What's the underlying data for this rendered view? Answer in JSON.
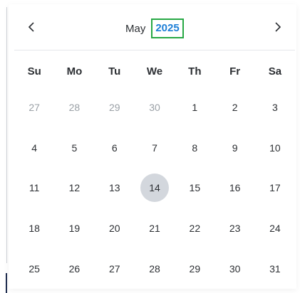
{
  "header": {
    "month": "May",
    "year": "2025",
    "prev_icon": "chevron-left-icon",
    "next_icon": "chevron-right-icon"
  },
  "weekdays": [
    "Su",
    "Mo",
    "Tu",
    "We",
    "Th",
    "Fr",
    "Sa"
  ],
  "days": [
    {
      "label": "27",
      "muted": true
    },
    {
      "label": "28",
      "muted": true
    },
    {
      "label": "29",
      "muted": true
    },
    {
      "label": "30",
      "muted": true
    },
    {
      "label": "1"
    },
    {
      "label": "2"
    },
    {
      "label": "3"
    },
    {
      "label": "4"
    },
    {
      "label": "5"
    },
    {
      "label": "6"
    },
    {
      "label": "7"
    },
    {
      "label": "8"
    },
    {
      "label": "9"
    },
    {
      "label": "10"
    },
    {
      "label": "11"
    },
    {
      "label": "12"
    },
    {
      "label": "13"
    },
    {
      "label": "14",
      "selected": true
    },
    {
      "label": "15"
    },
    {
      "label": "16"
    },
    {
      "label": "17"
    },
    {
      "label": "18"
    },
    {
      "label": "19"
    },
    {
      "label": "20"
    },
    {
      "label": "21"
    },
    {
      "label": "22"
    },
    {
      "label": "23"
    },
    {
      "label": "24"
    },
    {
      "label": "25"
    },
    {
      "label": "26"
    },
    {
      "label": "27"
    },
    {
      "label": "28"
    },
    {
      "label": "29"
    },
    {
      "label": "30"
    },
    {
      "label": "31"
    }
  ],
  "colors": {
    "year_text": "#1d7fd6",
    "year_outline": "#27a844",
    "selected_bg": "#d3d7dd",
    "muted_text": "#9aa0a6",
    "text": "#2c2f33"
  }
}
